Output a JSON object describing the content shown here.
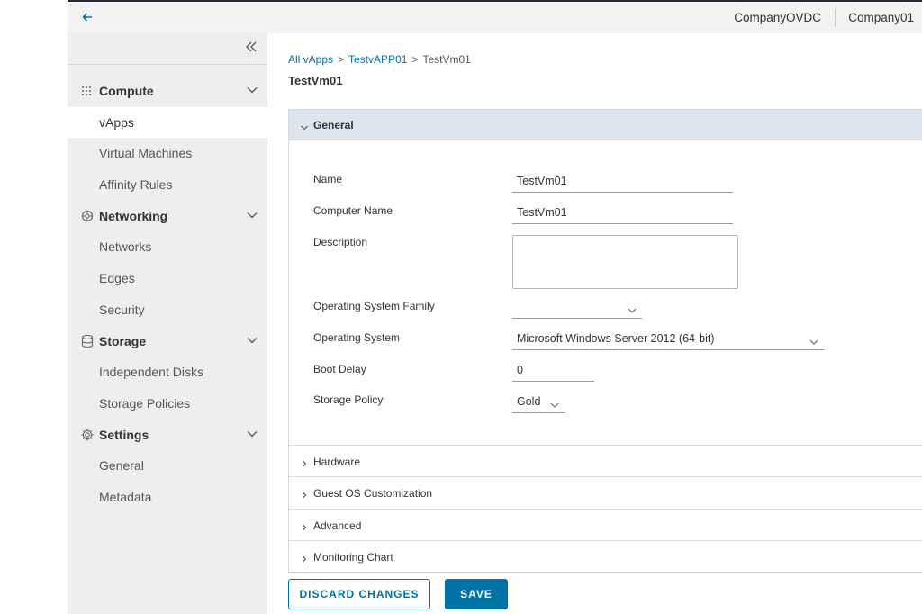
{
  "header": {
    "back_icon": "arrow-left-icon",
    "org_vdc": "CompanyOVDC",
    "org_name": "Company01"
  },
  "sidebar": {
    "collapse_icon": "double-chevron-left-icon",
    "sections": [
      {
        "label": "Compute",
        "icon": "grid-icon",
        "items": [
          "vApps",
          "Virtual Machines",
          "Affinity Rules"
        ]
      },
      {
        "label": "Networking",
        "icon": "network-icon",
        "items": [
          "Networks",
          "Edges",
          "Security"
        ]
      },
      {
        "label": "Storage",
        "icon": "database-icon",
        "items": [
          "Independent Disks",
          "Storage Policies"
        ]
      },
      {
        "label": "Settings",
        "icon": "gear-icon",
        "items": [
          "General",
          "Metadata"
        ]
      }
    ],
    "active_item": "vApps"
  },
  "breadcrumb": {
    "items": [
      "All vApps",
      "TestvAPP01",
      "TestVm01"
    ],
    "separator": ">"
  },
  "page": {
    "title": "TestVm01"
  },
  "general": {
    "title": "General",
    "fields": {
      "name": {
        "label": "Name",
        "value": "TestVm01"
      },
      "computer_name": {
        "label": "Computer Name",
        "value": "TestVm01"
      },
      "description": {
        "label": "Description",
        "value": ""
      },
      "os_family": {
        "label": "Operating System Family",
        "value": ""
      },
      "os": {
        "label": "Operating System",
        "value": "Microsoft Windows Server 2012 (64-bit)"
      },
      "boot_delay": {
        "label": "Boot Delay",
        "value": "0"
      },
      "storage_policy": {
        "label": "Storage Policy",
        "value": "Gold"
      }
    }
  },
  "sections": [
    "Hardware",
    "Guest OS Customization",
    "Advanced",
    "Monitoring Chart"
  ],
  "actions": {
    "discard": "DISCARD CHANGES",
    "save": "SAVE"
  },
  "colors": {
    "accent": "#0072a3",
    "header_band": "#dde6ed",
    "sidebar_bg": "#eeeeee",
    "topbar_border": "#1d2b3a"
  }
}
